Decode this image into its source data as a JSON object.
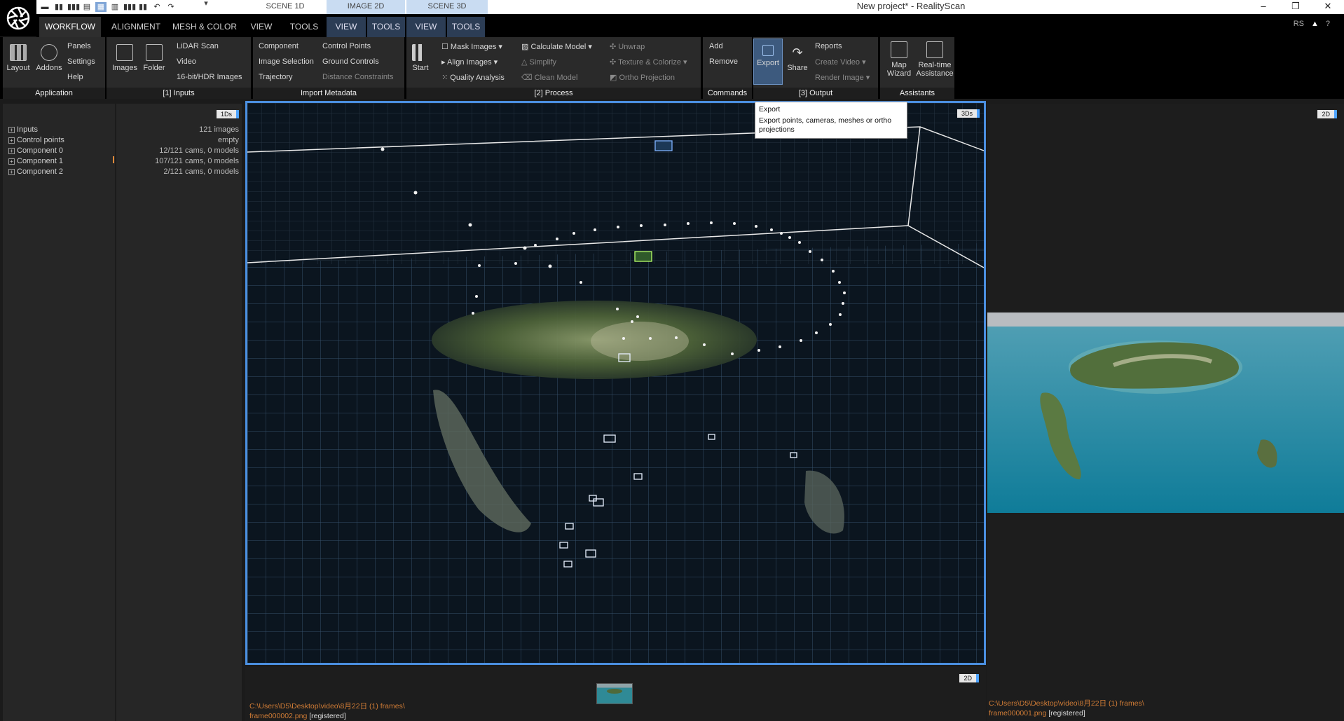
{
  "window": {
    "title": "New project* - RealityScan",
    "minimize": "–",
    "restore": "❐",
    "close": "✕"
  },
  "quickaccess": [
    "▬",
    "▮▮",
    "▮▮▮",
    "▤",
    "▦",
    "▥",
    "▮▮▮",
    "▮▮",
    "↶",
    "↷"
  ],
  "scene_tabs": {
    "scene1d": "SCENE 1D",
    "image2d": "IMAGE 2D",
    "scene3d": "SCENE 3D",
    "dropdown": "▾"
  },
  "menu": {
    "workflow": "WORKFLOW",
    "alignment": "ALIGNMENT",
    "mesh_color": "MESH & COLOR",
    "view": "VIEW",
    "tools": "TOOLS",
    "ctx_view1": "VIEW",
    "ctx_tools1": "TOOLS",
    "ctx_view2": "VIEW",
    "ctx_tools2": "TOOLS",
    "rs": "RS",
    "alert": "▲",
    "help": "?"
  },
  "ribbon": {
    "application": {
      "label": "Application",
      "layout": "Layout",
      "addons": "Addons",
      "panels": "Panels",
      "settings": "Settings",
      "help": "Help"
    },
    "inputs": {
      "label": "[1] Inputs",
      "images": "Images",
      "folder": "Folder",
      "lidar": "LiDAR Scan",
      "video": "Video",
      "hdr": "16-bit/HDR Images"
    },
    "metadata": {
      "label": "Import Metadata",
      "component": "Component",
      "image_selection": "Image Selection",
      "trajectory": "Trajectory",
      "control_points": "Control Points",
      "ground_controls": "Ground Controls",
      "distance_constraints": "Distance Constraints"
    },
    "process": {
      "label": "[2] Process",
      "start": "Start",
      "mask_images": "Mask Images",
      "align_images": "Align Images",
      "quality_analysis": "Quality Analysis",
      "calculate_model": "Calculate Model",
      "simplify": "Simplify",
      "clean_model": "Clean Model",
      "unwrap": "Unwrap",
      "texture_colorize": "Texture & Colorize",
      "ortho_projection": "Ortho Projection"
    },
    "commands": {
      "label": "Commands",
      "add": "Add",
      "remove": "Remove"
    },
    "output": {
      "label": "[3] Output",
      "export": "Export",
      "share": "Share",
      "reports": "Reports",
      "create_video": "Create Video",
      "render_image": "Render Image"
    },
    "assistants": {
      "label": "Assistants",
      "map_wizard_1": "Map",
      "map_wizard_2": "Wizard",
      "realtime_1": "Real-time",
      "realtime_2": "Assistance"
    }
  },
  "tree": {
    "badge": "1Ds",
    "items": [
      {
        "label": "Inputs",
        "value": "121 images"
      },
      {
        "label": "Control points",
        "value": "empty"
      },
      {
        "label": "Component 0",
        "value": "12/121 cams, 0 models"
      },
      {
        "label": "Component 1",
        "value": "107/121 cams, 0 models"
      },
      {
        "label": "Component 2",
        "value": "2/121 cams, 0 models"
      }
    ]
  },
  "viewport3d": {
    "badge": "3Ds"
  },
  "tooltip": {
    "title": "Export",
    "body": "Export points, cameras, meshes or ortho projections"
  },
  "bottom_view": {
    "badge": "2D",
    "path": "C:\\Users\\D5\\Desktop\\video\\8月22日 (1) frames\\",
    "file": "frame000002.png",
    "status": "[registered]"
  },
  "right_view": {
    "badge": "2D",
    "path": "C:\\Users\\D5\\Desktop\\video\\8月22日 (1) frames\\",
    "file": "frame000001.png",
    "status": "[registered]"
  },
  "colors": {
    "accent": "#4b8fe0",
    "path": "#d07c36",
    "ribbon_selected": "#3d5a7e"
  }
}
